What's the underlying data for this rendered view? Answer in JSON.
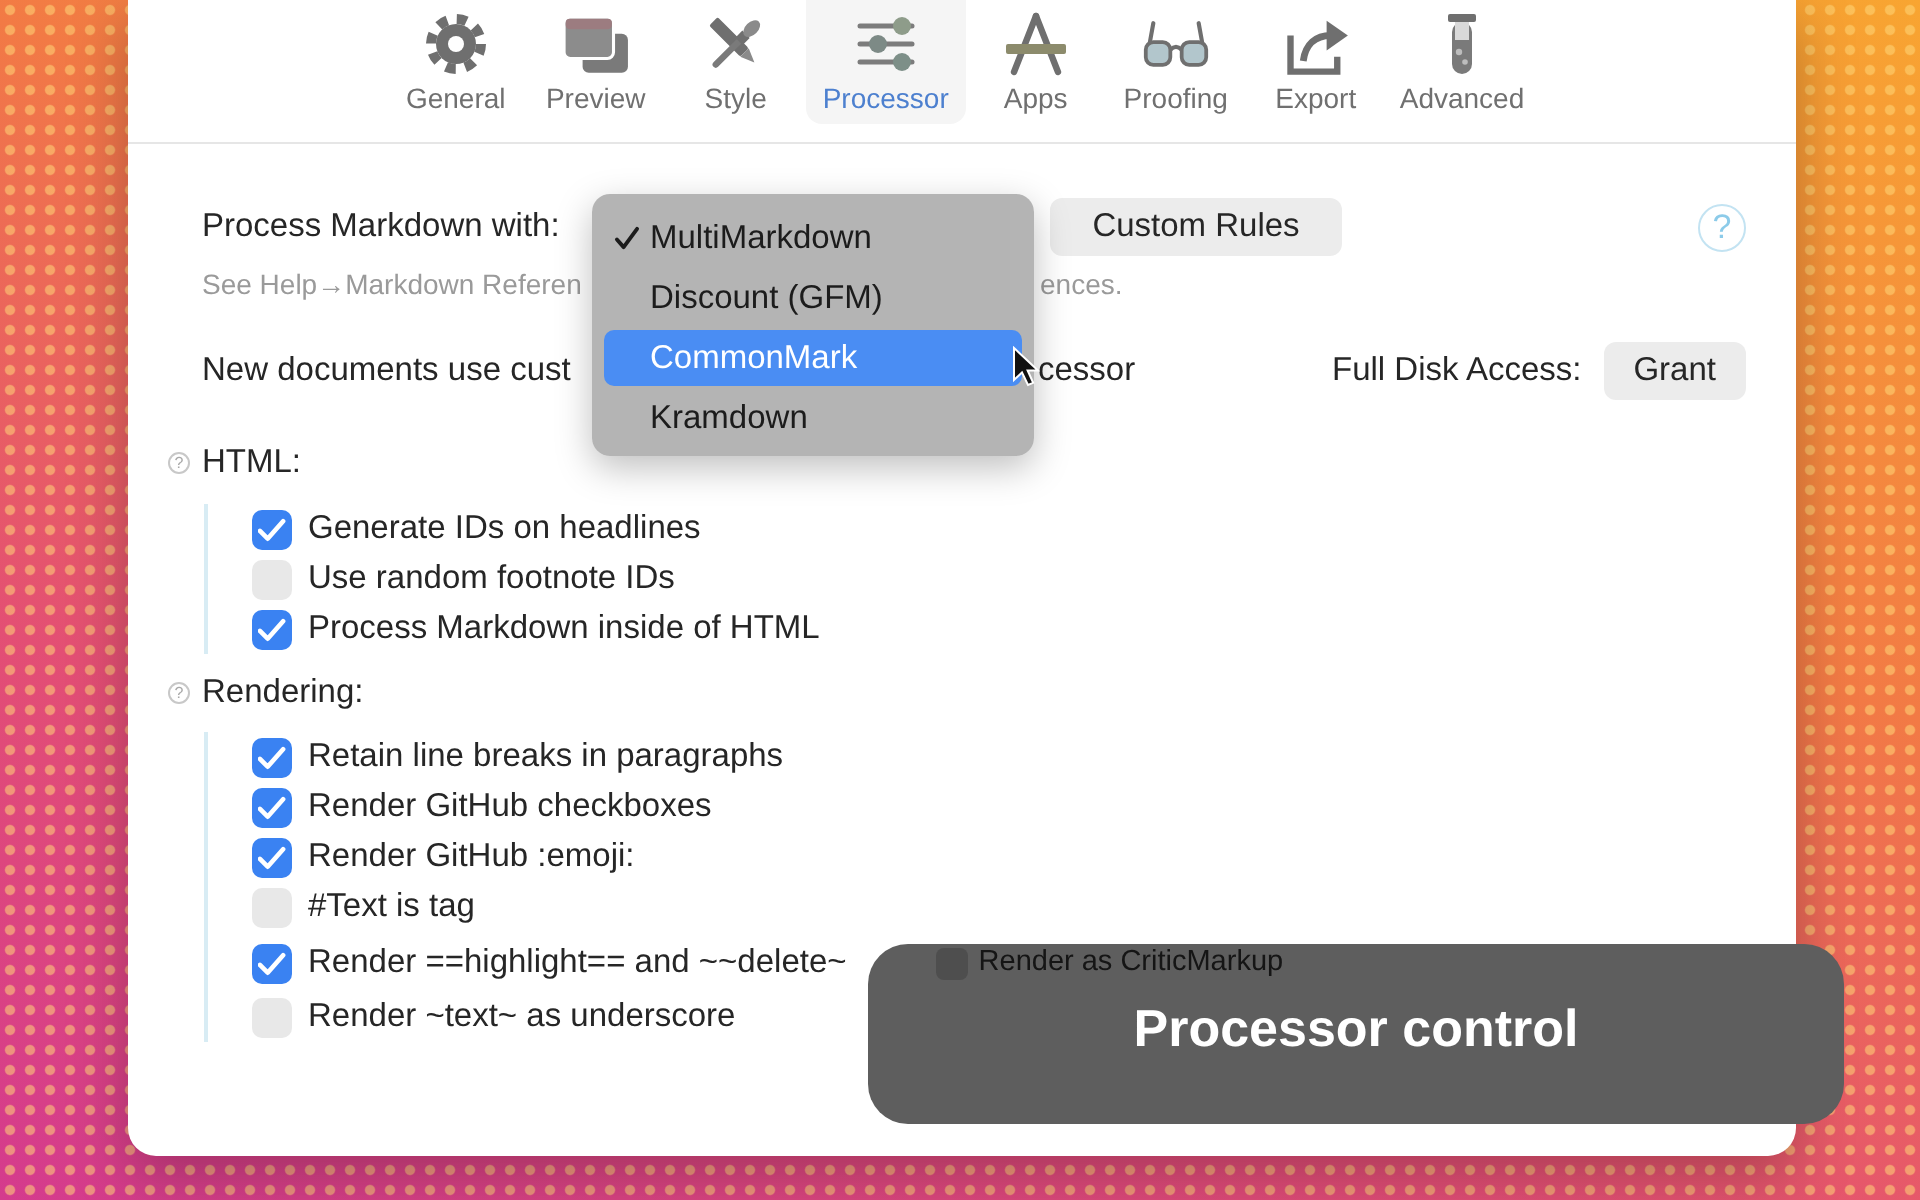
{
  "toolbar": {
    "tabs": [
      {
        "label": "General",
        "selected": false
      },
      {
        "label": "Preview",
        "selected": false
      },
      {
        "label": "Style",
        "selected": false
      },
      {
        "label": "Processor",
        "selected": true
      },
      {
        "label": "Apps",
        "selected": false
      },
      {
        "label": "Proofing",
        "selected": false
      },
      {
        "label": "Export",
        "selected": false
      },
      {
        "label": "Advanced",
        "selected": false
      }
    ]
  },
  "processor": {
    "label": "Process Markdown with:",
    "menu": {
      "items": [
        {
          "label": "MultiMarkdown",
          "checked": true,
          "highlighted": false
        },
        {
          "label": "Discount (GFM)",
          "checked": false,
          "highlighted": false
        },
        {
          "label": "CommonMark",
          "checked": false,
          "highlighted": true
        },
        {
          "label": "Kramdown",
          "checked": false,
          "highlighted": false
        }
      ]
    },
    "custom_rules_button": "Custom Rules",
    "help_button": "?"
  },
  "help_text": [
    "See Help→Markdown Referen",
    "ences."
  ],
  "custom_processor": {
    "text": [
      "New documents use cust",
      "cessor"
    ],
    "full_disk_access": {
      "label": "Full Disk Access:",
      "button": "Grant"
    }
  },
  "sections": [
    {
      "title": "HTML:",
      "help": "?",
      "options": [
        {
          "label": "Generate IDs on headlines",
          "checked": true
        },
        {
          "label": "Use random footnote IDs",
          "checked": false
        },
        {
          "label": "Process Markdown inside of HTML",
          "checked": true
        }
      ]
    },
    {
      "title": "Rendering:",
      "help": "?",
      "options": [
        {
          "label": "Retain line breaks in paragraphs",
          "checked": true
        },
        {
          "label": "Render GitHub checkboxes",
          "checked": true
        },
        {
          "label": "Render GitHub :emoji:",
          "checked": true
        },
        {
          "label": "#Text is tag",
          "checked": false
        },
        {
          "label": "Render ==highlight== and ~~delete~",
          "checked": true,
          "sub_option": {
            "label": "Render as CriticMarkup",
            "checked": false
          }
        },
        {
          "label": "Render ~text~ as underscore",
          "checked": false
        }
      ]
    }
  ],
  "caption": "Processor control"
}
